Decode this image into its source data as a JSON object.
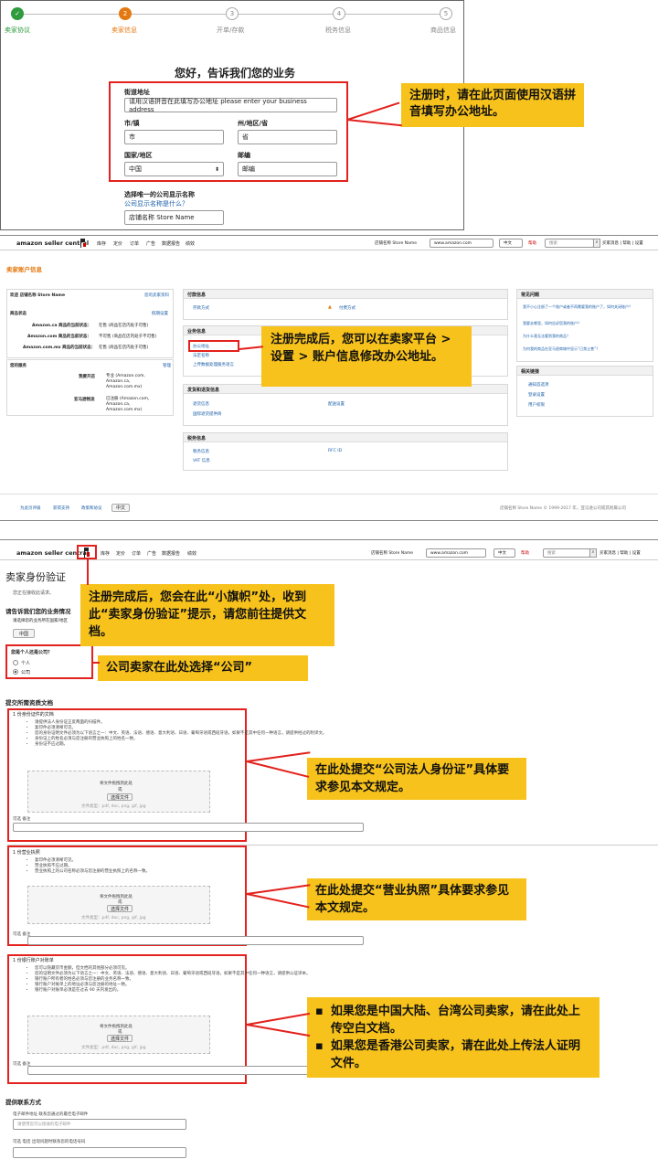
{
  "panel1": {
    "steps": [
      {
        "num": "",
        "label": "卖家协议",
        "state": "done"
      },
      {
        "num": "2",
        "label": "卖家信息",
        "state": "active"
      },
      {
        "num": "3",
        "label": "开单/存款",
        "state": "todo"
      },
      {
        "num": "4",
        "label": "税务信息",
        "state": "todo"
      },
      {
        "num": "5",
        "label": "商品信息",
        "state": "todo"
      }
    ],
    "heading": "您好，告诉我们您的业务",
    "street_label": "街道地址",
    "street_value": "请用汉语拼音在此填写办公地址 please enter your business address",
    "city_label": "市/镇",
    "city_value": "市",
    "state_label": "州/地区/省",
    "state_value": "省",
    "country_label": "国家/地区",
    "country_value": "中国",
    "zip_label": "邮编",
    "zip_value": "邮编",
    "display_name_label": "选择唯一的公司显示名称",
    "display_name_help": "公司显示名称是什么？",
    "display_name_value": "店铺名称 Store Name",
    "callout": "注册时，请在此页面使用汉语拼音填写办公地址。"
  },
  "panel2": {
    "logo": "amazon seller central",
    "nav": [
      "库存",
      "定价",
      "订单",
      "广告",
      "数据报告",
      "绩效"
    ],
    "store_name": "店铺名称 Store Name",
    "site": "www.amazon.com",
    "lang": "中文",
    "msg": "帮助",
    "search_placeholder": "搜索",
    "top_links": "买家消息 | 帮助 | 设置",
    "page_title": "卖家账户信息",
    "left_box": {
      "head": "欢迎 店铺名称 Store Name",
      "head_link": "您的卖家资料",
      "listing_head": "商品状态",
      "listing_link": "假期设置",
      "rows": [
        {
          "k": "Amazon.ca 商品的当前状态：",
          "v": "在售 (商品在店内处于可售)"
        },
        {
          "k": "Amazon.com 商品的当前状态：",
          "v": "不可售 (商品在店内处于不可售)"
        },
        {
          "k": "Amazon.com.mx 商品的当前状态：",
          "v": "在售 (商品在店内处于可售)"
        }
      ],
      "services_head": "您的服务",
      "services_link": "管理",
      "svc1_k": "我要开店",
      "svc1_v": "专业 (Amazon.com, Amazon.ca, Amazon.com.mx)",
      "svc2_k": "亚马逊物流",
      "svc2_v": "已注册 (Amazon.com, Amazon.ca, Amazon.com.mx)"
    },
    "mid": {
      "pay_head": "付款信息",
      "pay_l": "存款方式",
      "pay_r": "付费方式",
      "biz_head": "业务信息",
      "biz_1": "办公地址",
      "biz_2": "法定名称",
      "biz_3": "上传数据处理服务语言",
      "ship_head": "发货和退货信息",
      "ship_l": "退货信息",
      "ship_r": "配送设置",
      "ship_2": "国际退货提供商",
      "tax_head": "税务信息",
      "tax_l": "税务信息",
      "tax_r": "RFC ID",
      "tax_2": "VAT 信息"
    },
    "right": {
      "faq_head": "常见问题",
      "faq": [
        "我不小心注册了一个账户或者不再需要我的账户了，如何关闭账户？",
        "我要去哪里，如何告诉您我的账户？",
        "为什么我无法看到我的商品？",
        "为何我的商品在亚马逊商城中显示“已禁止售”？"
      ],
      "rel_head": "相关链接",
      "rel": [
        "通知首选项",
        "登录设置",
        "用户权限"
      ]
    },
    "footer_links": [
      "为此页评级",
      "获得支持",
      "政策和协议",
      "中文"
    ],
    "footer_right": "店铺名称 Store Name    © 1999-2017 年，亚马逊公司或其附属公司",
    "callout": "注册完成后，您可以在卖家平台 > 设置 > 账户信息修改办公地址。"
  },
  "panel3": {
    "page_title": "卖家身份验证",
    "intro": "您正在接收此请求。",
    "q1": "请告诉我们您的业务情况",
    "q1_sub": "请选择您的业务所在国家/地区",
    "country": "中国",
    "q2": "您是个人还是公司？",
    "opt_person": "个人",
    "opt_company": "公司",
    "submit_head": "提交所需资质文档",
    "doc1_title": "1 份身份证件的文档",
    "doc1_bullets": [
      "请提供法人身份证正反两面的扫描件。",
      "复印件必须清晰可见。",
      "您的身份证明文件必须为以下语言之一：中文、英语、法语、德语、意大利语、日语、葡萄牙语或西班牙语。如果不是其中任何一种语言，请提供经过的附译文。",
      "身份证上的姓名必须与您注册的营业执照上的姓名一致。",
      "身份证不应过期。"
    ],
    "doc2_title": "1 份营业执照",
    "doc2_bullets": [
      "复印件必须清晰可见。",
      "营业执照不应过期。",
      "营业执照上的公司名称必须与您注册的营业执照上的名称一致。"
    ],
    "doc3_title": "1 份银行账户对账单",
    "doc3_bullets": [
      "您可以隐藏货币金额，但文档的其他部分必须可见。",
      "您的证明文件必须为以下语言之一：中文、英语、法语、德语、意大利语、日语、葡萄牙语或西班牙语。如果不是其中任何一种语言，请提供公证译本。",
      "银行账户所有者的姓名必须与您注册的业务名称一致。",
      "银行账户对账单上的地址必须与您注册的地址一致。",
      "银行账户对账单必须是在过去 90 天内发出的。"
    ],
    "drop_title": "将文件拖拽到此处",
    "drop_or": "或",
    "drop_btn": "选择文件",
    "drop_types": "文件类型：pdf, doc, png, gif, jpg",
    "note_label": "可选 备注",
    "contact_head": "提供联系方式",
    "email_label": "电子邮件地址 联系您通过的最佳电子邮件",
    "email_placeholder": "请使用您可以接收的电子邮件",
    "phone_label": "可选 电话 出现问题时联系您的电话号码",
    "callout_flag": "注册完成后，您会在此“小旗帜”处，收到此“卖家身份验证”提示，请您前往提供文档。",
    "callout_company": "公司卖家在此处选择“公司”",
    "callout_id": "在此处提交“公司法人身份证”具体要求参见本文规定。",
    "callout_license": "在此处提交“营业执照”具体要求参见本文规定。",
    "callout_bank_1": "如果您是中国大陆、台湾公司卖家，请在此处上传空白文档。",
    "callout_bank_2": "如果您是香港公司卖家，请在此处上传法人证明文件。"
  },
  "colors": {
    "callout_bg": "#f7c21b",
    "red": "#e3211d",
    "link": "#1a5ea8",
    "done": "#2e9b3e",
    "active": "#e47911"
  }
}
